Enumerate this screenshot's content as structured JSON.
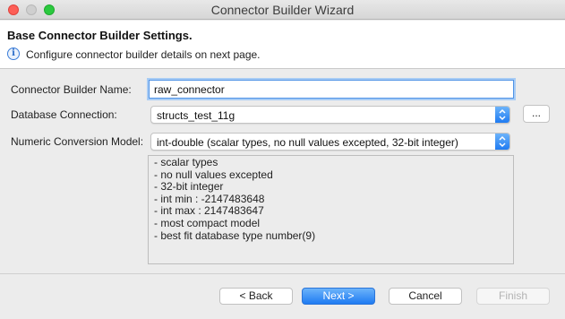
{
  "window": {
    "title": "Connector Builder Wizard"
  },
  "banner": {
    "title": "Base Connector Builder Settings.",
    "message": "Configure connector builder details on next page."
  },
  "form": {
    "name_label": "Connector Builder Name:",
    "name_value": "raw_connector",
    "db_label": "Database Connection:",
    "db_value": "structs_test_11g",
    "browse_label": "...",
    "numeric_label": "Numeric Conversion Model:",
    "numeric_value": "int-double (scalar types, no null values excepted, 32-bit integer)"
  },
  "details": {
    "lines": [
      "- scalar types",
      "- no null values excepted",
      "- 32-bit integer",
      "- int min : -2147483648",
      "- int max : 2147483647",
      "- most compact model",
      "- best fit database type number(9)"
    ]
  },
  "buttons": {
    "back": "< Back",
    "next": "Next >",
    "cancel": "Cancel",
    "finish": "Finish"
  },
  "icons": {
    "info": "info-icon",
    "dropdown": "chevron-updown-icon"
  },
  "colors": {
    "accent": "#1f7bf2",
    "focus_ring": "#a8ccf5"
  }
}
